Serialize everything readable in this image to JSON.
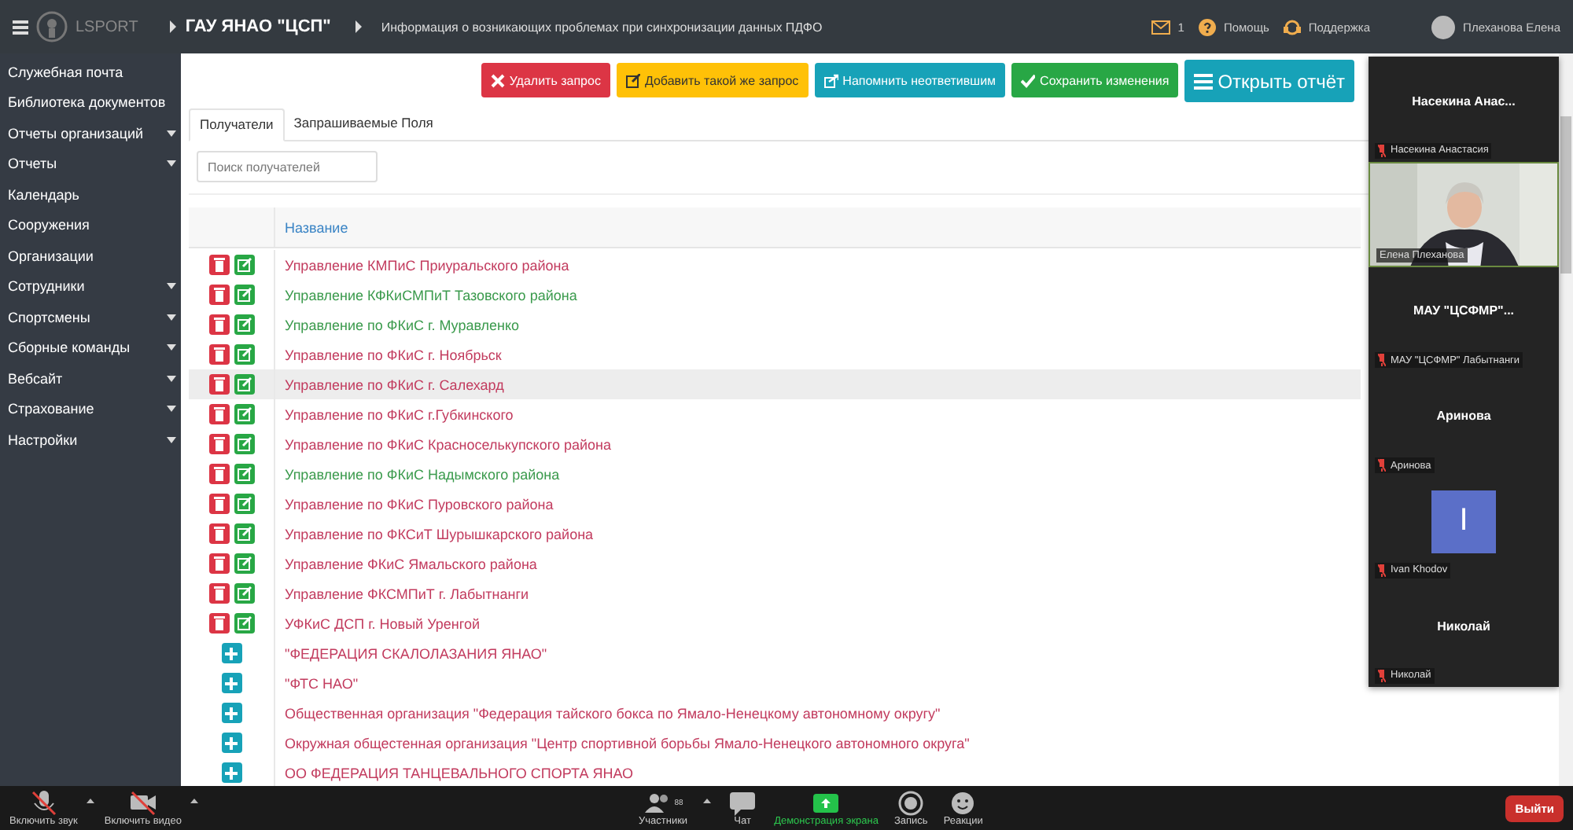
{
  "topbar": {
    "logo": "LSPORT",
    "breadcrumbs": [
      "ГАУ ЯНАО \"ЦСП\"",
      "Информация о возникающих проблемах при синхронизации данных ПДФО"
    ],
    "mail_count": "1",
    "help": "Помощь",
    "support": "Поддержка",
    "user": "Плеханова Елена"
  },
  "sidebar": {
    "items": [
      {
        "label": "Служебная почта",
        "expandable": false
      },
      {
        "label": "Библиотека документов",
        "expandable": false
      },
      {
        "label": "Отчеты организаций",
        "expandable": true
      },
      {
        "label": "Отчеты",
        "expandable": true
      },
      {
        "label": "Календарь",
        "expandable": false
      },
      {
        "label": "Сооружения",
        "expandable": false
      },
      {
        "label": "Организации",
        "expandable": false
      },
      {
        "label": "Сотрудники",
        "expandable": true
      },
      {
        "label": "Спортсмены",
        "expandable": true
      },
      {
        "label": "Сборные команды",
        "expandable": true
      },
      {
        "label": "Вебсайт",
        "expandable": true
      },
      {
        "label": "Страхование",
        "expandable": true
      },
      {
        "label": "Настройки",
        "expandable": true
      }
    ]
  },
  "actions": [
    {
      "kind": "delete",
      "label": "Удалить запрос"
    },
    {
      "kind": "duplicate",
      "label": "Добавить такой же запрос"
    },
    {
      "kind": "remind",
      "label": "Напомнить неответившим"
    },
    {
      "kind": "save",
      "label": "Сохранить изменения"
    },
    {
      "kind": "report",
      "label": "Открыть отчёт"
    }
  ],
  "tabs": [
    {
      "label": "Получатели",
      "selected": true
    },
    {
      "label": "Запрашиваемые Поля",
      "selected": false
    }
  ],
  "search": {
    "placeholder": "Поиск получателей"
  },
  "table": {
    "columns": [
      "Название"
    ],
    "rows": [
      {
        "kind": "member",
        "name": "Управление КМПиС Приуральского района",
        "color": "#c23b5e",
        "selected": false
      },
      {
        "kind": "member",
        "name": "Управление КФКиСМПиТ Тазовского района",
        "color": "#3a9a4c",
        "selected": false
      },
      {
        "kind": "member",
        "name": "Управление по ФКиС г. Муравленко",
        "color": "#3a9a4c",
        "selected": false
      },
      {
        "kind": "member",
        "name": "Управление по ФКиС г. Ноябрьск",
        "color": "#c23b5e",
        "selected": false
      },
      {
        "kind": "member",
        "name": "Управление по ФКиС г. Салехард",
        "color": "#c23b5e",
        "selected": true
      },
      {
        "kind": "member",
        "name": "Управление по ФКиС г.Губкинского",
        "color": "#c23b5e",
        "selected": false
      },
      {
        "kind": "member",
        "name": "Управление по ФКиС Красноселькупского района",
        "color": "#c23b5e",
        "selected": false
      },
      {
        "kind": "member",
        "name": "Управление по ФКиС Надымского района",
        "color": "#3a9a4c",
        "selected": false
      },
      {
        "kind": "member",
        "name": "Управление по ФКиС Пуровского района",
        "color": "#c23b5e",
        "selected": false
      },
      {
        "kind": "member",
        "name": "Управление по ФКСиТ Шурышкарского района",
        "color": "#c23b5e",
        "selected": false
      },
      {
        "kind": "member",
        "name": "Управление ФКиС Ямальского района",
        "color": "#c23b5e",
        "selected": false
      },
      {
        "kind": "member",
        "name": "Управление ФКСМПиТ г. Лабытнанги",
        "color": "#c23b5e",
        "selected": false
      },
      {
        "kind": "member",
        "name": "УФКиС ДСП г. Новый Уренгой",
        "color": "#c23b5e",
        "selected": false
      },
      {
        "kind": "candidate",
        "name": "\"ФЕДЕРАЦИЯ СКАЛОЛАЗАНИЯ ЯНАО\"",
        "color": "#c23b5e",
        "selected": false
      },
      {
        "kind": "candidate",
        "name": "\"ФТС НАО\"",
        "color": "#c23b5e",
        "selected": false
      },
      {
        "kind": "candidate",
        "name": "Общественная организация \"Федерация тайского бокса по Ямало-Ненецкому автономному округу\"",
        "color": "#c23b5e",
        "selected": false
      },
      {
        "kind": "candidate",
        "name": "Окружная общестенная организация \"Центр спортивной борьбы Ямало-Ненецкого автономного округа\"",
        "color": "#c23b5e",
        "selected": false
      },
      {
        "kind": "candidate",
        "name": "ОО ФЕДЕРАЦИЯ ТАНЦЕВАЛЬНОГО СПОРТА ЯНАО",
        "color": "#c23b5e",
        "selected": false
      }
    ]
  },
  "participants": [
    {
      "kind": "name",
      "title": "Насекина  Анас...",
      "caption": "Насекина Анастасия",
      "muted": true
    },
    {
      "kind": "video",
      "caption": "Елена Плеханова",
      "muted": false
    },
    {
      "kind": "name",
      "title": "МАУ  \"ЦСФМР\"...",
      "caption": "МАУ \"ЦСФМР\" Лабытнанги",
      "muted": true
    },
    {
      "kind": "name",
      "title": "Аринова",
      "caption": "Аринова",
      "muted": true
    },
    {
      "kind": "avatar",
      "title": "I",
      "caption": "Ivan Khodov",
      "muted": true
    },
    {
      "kind": "name",
      "title": "Николай",
      "caption": "Николай",
      "muted": true
    }
  ],
  "meeting_toolbar": {
    "left": [
      {
        "kind": "mic",
        "label": "Включить звук"
      },
      {
        "kind": "camera",
        "label": "Включить видео"
      }
    ],
    "center": [
      {
        "kind": "participants",
        "label": "Участники",
        "count": "88"
      },
      {
        "kind": "chat",
        "label": "Чат"
      },
      {
        "kind": "share",
        "label": "Демонстрация экрана"
      },
      {
        "kind": "record",
        "label": "Запись"
      },
      {
        "kind": "reactions",
        "label": "Реакции"
      }
    ],
    "leave": "Выйти"
  }
}
